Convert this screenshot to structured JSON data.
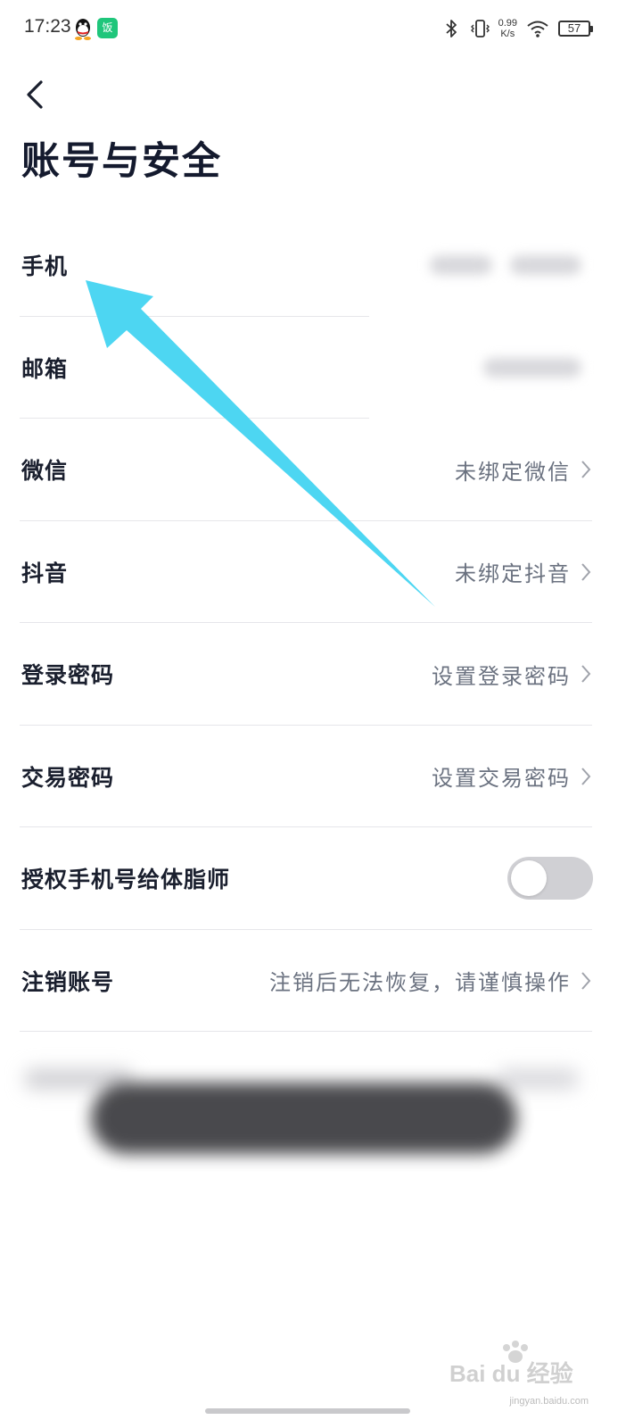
{
  "status_bar": {
    "time": "17:23",
    "app_icon_text": "饭",
    "net_speed_value": "0.99",
    "net_speed_unit": "K/s",
    "battery": "57",
    "icons": [
      "qq-icon",
      "app-icon",
      "bluetooth-icon",
      "vibrate-icon",
      "wifi-icon",
      "battery-icon"
    ]
  },
  "header": {
    "back_icon": "chevron-left-icon",
    "title": "账号与安全"
  },
  "settings": {
    "items": [
      {
        "label": "手机",
        "value": "",
        "value_blurred": true
      },
      {
        "label": "邮箱",
        "value": "",
        "value_blurred": true
      },
      {
        "label": "微信",
        "value": "未绑定微信"
      },
      {
        "label": "抖音",
        "value": "未绑定抖音"
      },
      {
        "label": "登录密码",
        "value": "设置登录密码"
      },
      {
        "label": "交易密码",
        "value": "设置交易密码"
      },
      {
        "label": "授权手机号给体脂师",
        "toggle": false
      },
      {
        "label": "注销账号",
        "value": "注销后无法恢复，请谨慎操作"
      }
    ]
  },
  "colors": {
    "title": "#141a2e",
    "value_text": "#6b7280",
    "divider": "#e6e6ea",
    "toggle_off": "#d0d0d4",
    "annotation_arrow": "#4dd6f2"
  },
  "watermark": {
    "logo_text": "Bai du 经验",
    "url": "jingyan.baidu.com"
  }
}
